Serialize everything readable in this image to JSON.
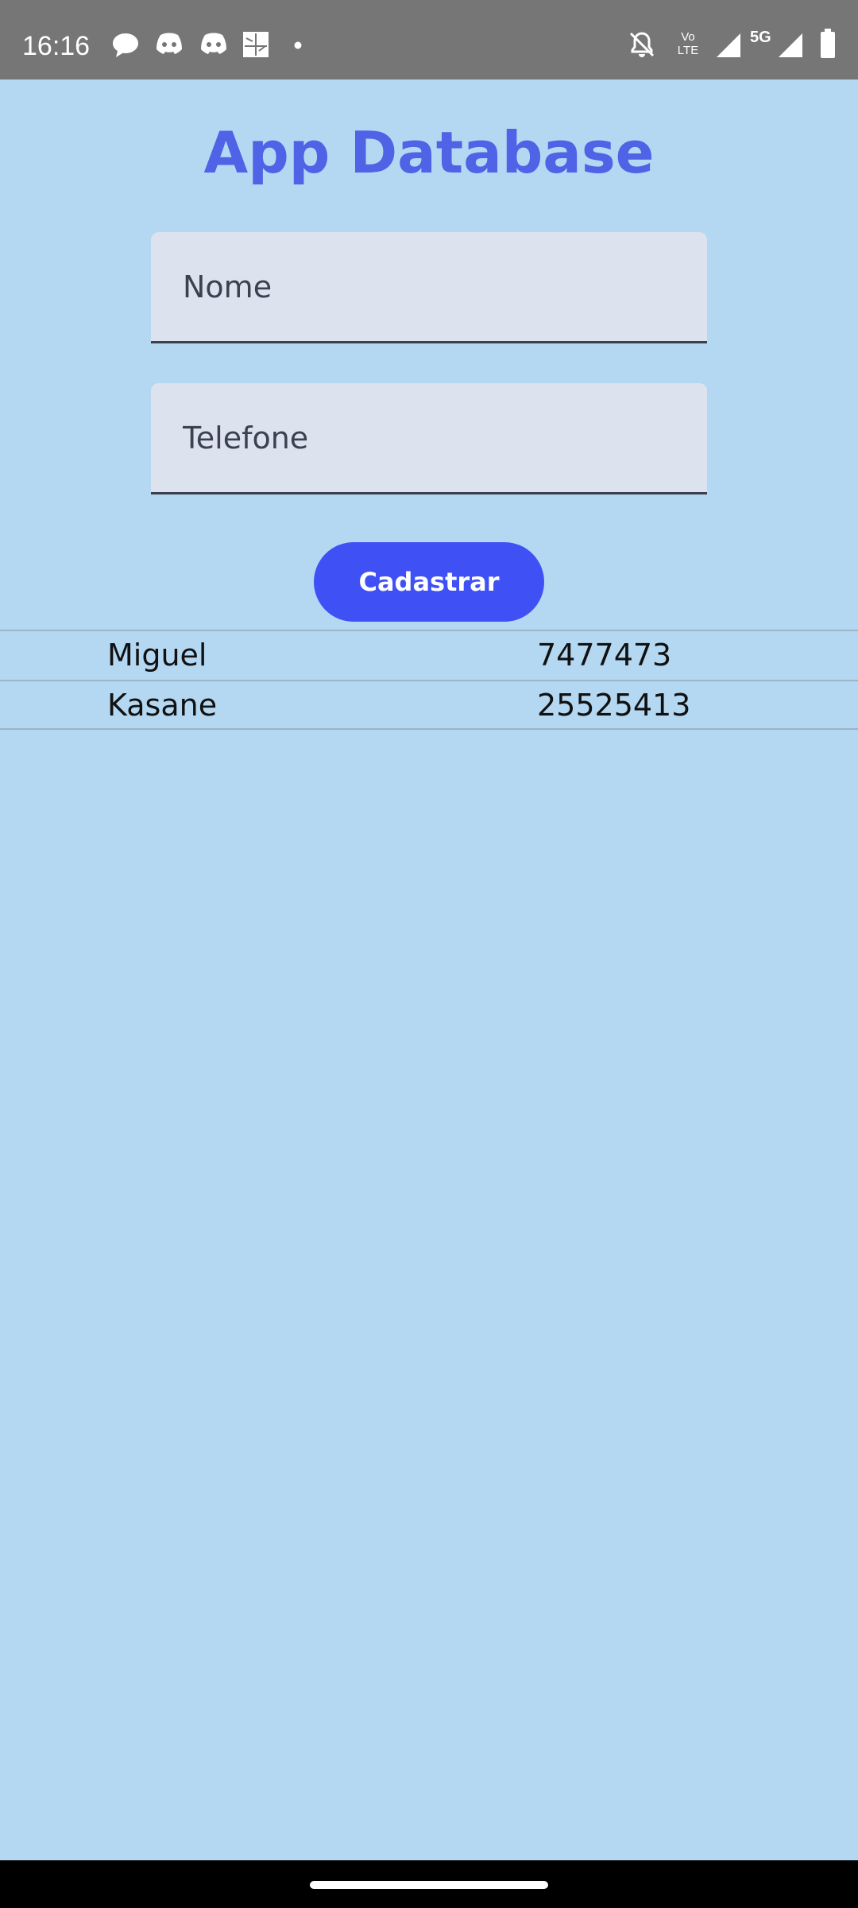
{
  "status_bar": {
    "time": "16:16",
    "left_icons": [
      "chat-bubble-icon",
      "discord-icon",
      "discord-icon",
      "gallery-icon",
      "dot-icon"
    ],
    "right_icons": [
      "bell-off-icon",
      "volte-icon",
      "signal-icon",
      "5g-signal-icon",
      "battery-icon"
    ],
    "volte_label_top": "Vo",
    "volte_label_bottom": "LTE",
    "network_label": "5G"
  },
  "app": {
    "title": "App Database",
    "title_color": "#4f63e6",
    "name_field": {
      "placeholder": "Nome",
      "value": ""
    },
    "phone_field": {
      "placeholder": "Telefone",
      "value": ""
    },
    "submit_label": "Cadastrar",
    "button_color": "#3f51f5",
    "background_color": "#b4d8f2",
    "contacts": [
      {
        "name": "Miguel",
        "phone": "7477473"
      },
      {
        "name": "Kasane",
        "phone": "25525413"
      }
    ]
  }
}
